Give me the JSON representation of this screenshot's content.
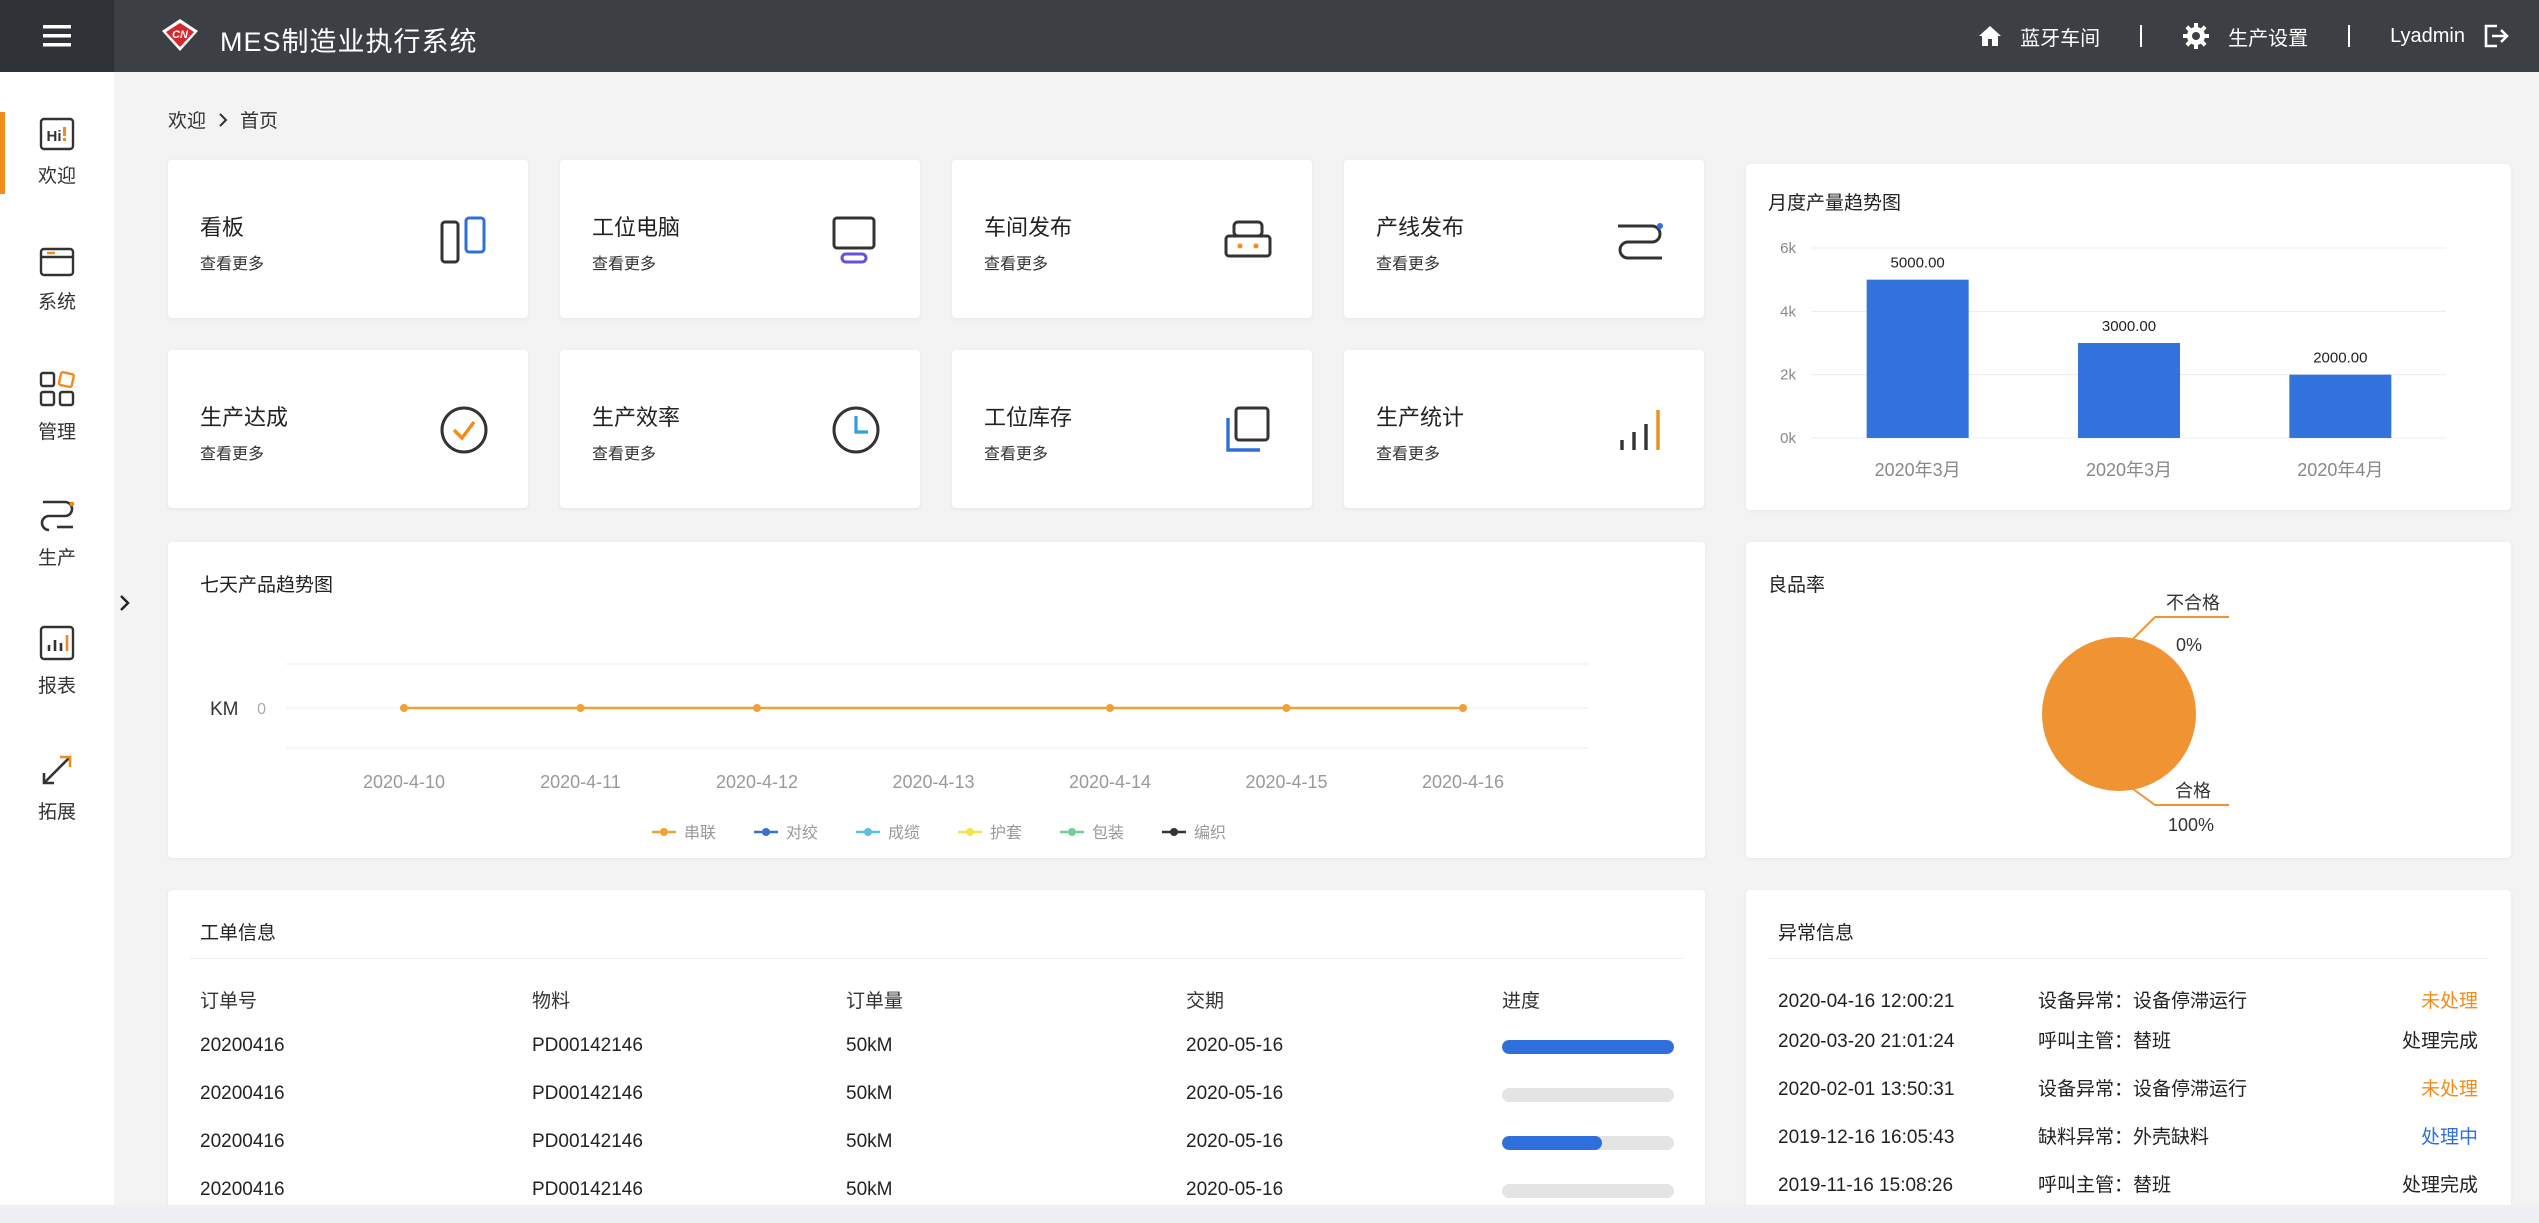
{
  "app": {
    "title": "MES制造业执行系统",
    "logo_text": "CN"
  },
  "topbar": {
    "workshop": "蓝牙车间",
    "settings": "生产设置",
    "user": "Lyadmin"
  },
  "sidebar": {
    "items": [
      {
        "label": "欢迎",
        "icon": "hi-icon"
      },
      {
        "label": "系统",
        "icon": "window-icon"
      },
      {
        "label": "管理",
        "icon": "grid-icon"
      },
      {
        "label": "生产",
        "icon": "route-icon"
      },
      {
        "label": "报表",
        "icon": "report-icon"
      },
      {
        "label": "拓展",
        "icon": "expand-icon"
      }
    ]
  },
  "breadcrumb": {
    "home": "欢迎",
    "current": "首页"
  },
  "tiles": [
    {
      "title": "看板",
      "more": "查看更多"
    },
    {
      "title": "工位电脑",
      "more": "查看更多"
    },
    {
      "title": "车间发布",
      "more": "查看更多"
    },
    {
      "title": "产线发布",
      "more": "查看更多"
    },
    {
      "title": "生产达成",
      "more": "查看更多"
    },
    {
      "title": "生产效率",
      "more": "查看更多"
    },
    {
      "title": "工位库存",
      "more": "查看更多"
    },
    {
      "title": "生产统计",
      "more": "查看更多"
    }
  ],
  "colors": {
    "accent": "#f08c1a",
    "primary": "#2f6fdb",
    "topbar": "#3c3f44"
  },
  "chart_data": [
    {
      "type": "bar",
      "title": "月度产量趋势图",
      "categories": [
        "2020年3月",
        "2020年3月",
        "2020年4月"
      ],
      "values": [
        5000,
        3000,
        2000
      ],
      "value_labels": [
        "5000.00",
        "3000.00",
        "2000.00"
      ],
      "yticks": [
        "0k",
        "2k",
        "4k",
        "6k"
      ],
      "ylim": [
        0,
        6000
      ],
      "color": "#3373de"
    },
    {
      "type": "line",
      "title": "七天产品趋势图",
      "ylabel": "KM",
      "yticks": [
        "0"
      ],
      "x": [
        "2020-4-10",
        "2020-4-11",
        "2020-4-12",
        "2020-4-13",
        "2020-4-14",
        "2020-4-15",
        "2020-4-16"
      ],
      "series": [
        {
          "name": "串联",
          "color": "#f0a035",
          "values": [
            0,
            0,
            0,
            null,
            0,
            0,
            0
          ]
        },
        {
          "name": "对绞",
          "color": "#3a6fd0",
          "values": []
        },
        {
          "name": "成缆",
          "color": "#5bc0de",
          "values": []
        },
        {
          "name": "护套",
          "color": "#f5e14a",
          "values": []
        },
        {
          "name": "包装",
          "color": "#6fcf97",
          "values": []
        },
        {
          "name": "编织",
          "color": "#333333",
          "values": []
        }
      ],
      "legend": "bottom"
    },
    {
      "type": "pie",
      "title": "良品率",
      "slices": [
        {
          "name": "不合格",
          "value": 0,
          "label": "0%"
        },
        {
          "name": "合格",
          "value": 100,
          "label": "100%"
        }
      ],
      "color": "#f09433"
    }
  ],
  "work_orders": {
    "title": "工单信息",
    "headers": [
      "订单号",
      "物料",
      "订单量",
      "交期",
      "进度"
    ],
    "rows": [
      {
        "order": "20200416",
        "material": "PD00142146",
        "qty": "50kM",
        "due": "2020-05-16",
        "progress": 1.0
      },
      {
        "order": "20200416",
        "material": "PD00142146",
        "qty": "50kM",
        "due": "2020-05-16",
        "progress": 0.0
      },
      {
        "order": "20200416",
        "material": "PD00142146",
        "qty": "50kM",
        "due": "2020-05-16",
        "progress": 0.58
      },
      {
        "order": "20200416",
        "material": "PD00142146",
        "qty": "50kM",
        "due": "2020-05-16",
        "progress": 0.0
      }
    ]
  },
  "abnormal": {
    "title": "异常信息",
    "rows": [
      {
        "time": "2020-04-16  12:00:21",
        "desc": "设备异常：设备停滞运行",
        "status": "未处理",
        "tone": "orange"
      },
      {
        "time": "2020-03-20  21:01:24",
        "desc": "呼叫主管：替班",
        "status": "处理完成",
        "tone": "dark"
      },
      {
        "time": "2020-02-01  13:50:31",
        "desc": "设备异常：设备停滞运行",
        "status": "未处理",
        "tone": "orange"
      },
      {
        "time": "2019-12-16  16:05:43",
        "desc": "缺料异常：外壳缺料",
        "status": "处理中",
        "tone": "blue"
      },
      {
        "time": "2019-11-16  15:08:26",
        "desc": "呼叫主管：替班",
        "status": "处理完成",
        "tone": "dark"
      }
    ]
  }
}
